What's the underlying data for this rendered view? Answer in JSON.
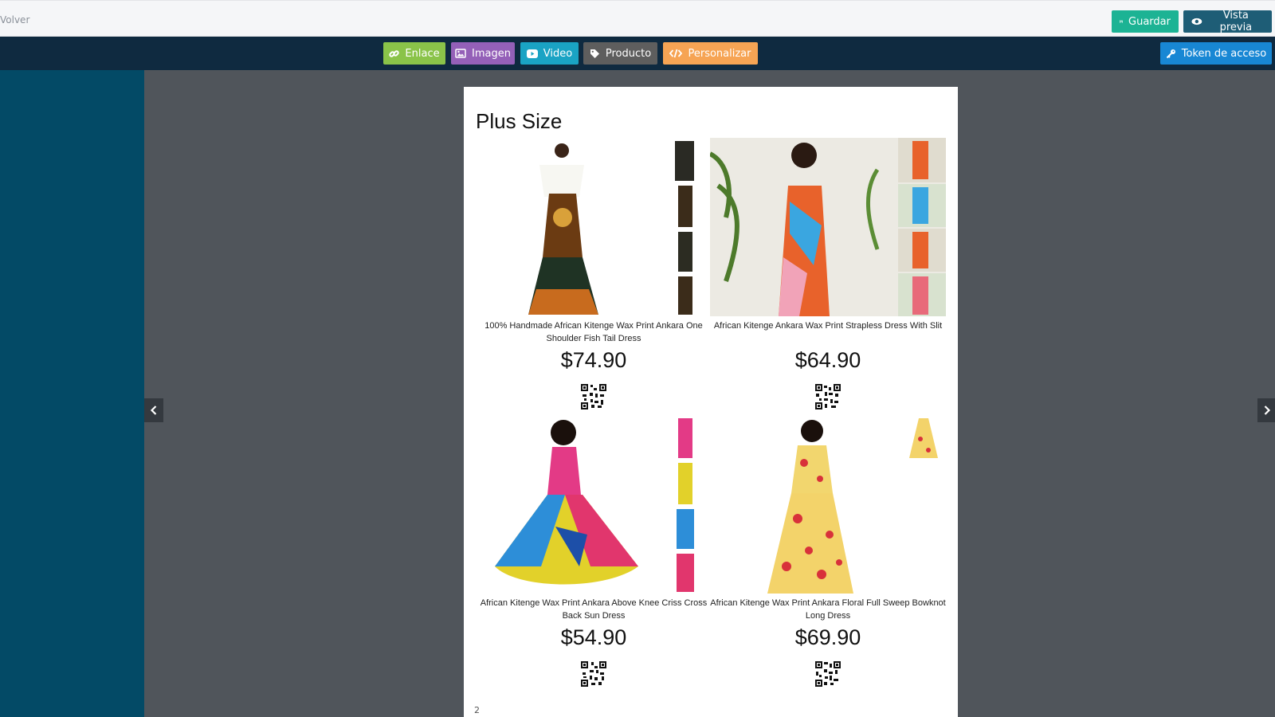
{
  "header": {
    "back_label": "Volver",
    "save_label": "Guardar",
    "preview_label": "Vista previa"
  },
  "toolbar": {
    "link_label": "Enlace",
    "image_label": "Imagen",
    "video_label": "Video",
    "product_label": "Producto",
    "customize_label": "Personalizar",
    "token_label": "Token de acceso"
  },
  "page": {
    "title": "Plus Size",
    "page_number": "2",
    "products": [
      {
        "name": "100% Handmade African Kitenge Wax Print Ankara One Shoulder Fish Tail Dress",
        "price": "$74.90"
      },
      {
        "name": "African Kitenge Ankara Wax Print Strapless Dress With Slit",
        "price": "$64.90"
      },
      {
        "name": "African Kitenge Wax Print Ankara Above Knee Criss Cross Back Sun Dress",
        "price": "$54.90"
      },
      {
        "name": "African Kitenge Wax Print Ankara Floral Full Sweep Bowknot Long Dress",
        "price": "$69.90"
      }
    ]
  },
  "colors": {
    "save": "#1cb394",
    "preview": "#1e5d76",
    "link": "#8ac349",
    "image": "#9460b8",
    "video": "#1aa3c4",
    "product": "#5e5e5e",
    "customize": "#f6a454",
    "token": "#1887d4",
    "sidebar": "#034a66",
    "toolbar": "#0f2a40"
  }
}
